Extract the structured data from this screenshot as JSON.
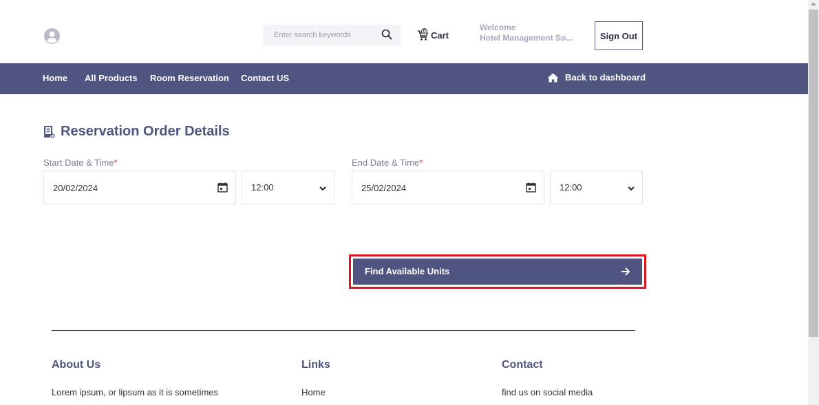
{
  "header": {
    "search_placeholder": "Enter search keywords",
    "cart_count": "0",
    "cart_label": "Cart",
    "welcome_label": "Welcome",
    "user_name": "Hotel Management So...",
    "signout_label": "Sign Out"
  },
  "nav": {
    "items": [
      {
        "label": "Home"
      },
      {
        "label": "All Products"
      },
      {
        "label": "Room Reservation"
      },
      {
        "label": "Contact US"
      }
    ],
    "back_label": "Back to dashboard"
  },
  "main": {
    "title": "Reservation Order Details",
    "start": {
      "label": "Start Date & Time",
      "required_mark": "*",
      "date": "20/02/2024",
      "time": "12:00"
    },
    "end": {
      "label": "End Date & Time",
      "required_mark": "*",
      "date": "25/02/2024",
      "time": "12:00"
    },
    "find_label": "Find Available Units"
  },
  "footer": {
    "about": {
      "heading": "About Us",
      "text": "Lorem ipsum, or lipsum as it is sometimes"
    },
    "links": {
      "heading": "Links",
      "text": "Home"
    },
    "contact": {
      "heading": "Contact",
      "text": "find us on social media"
    }
  },
  "colors": {
    "primary": "#4f5480",
    "highlight_border": "#e0141e",
    "required": "#e0342d",
    "muted_text": "#a6a9bd"
  }
}
